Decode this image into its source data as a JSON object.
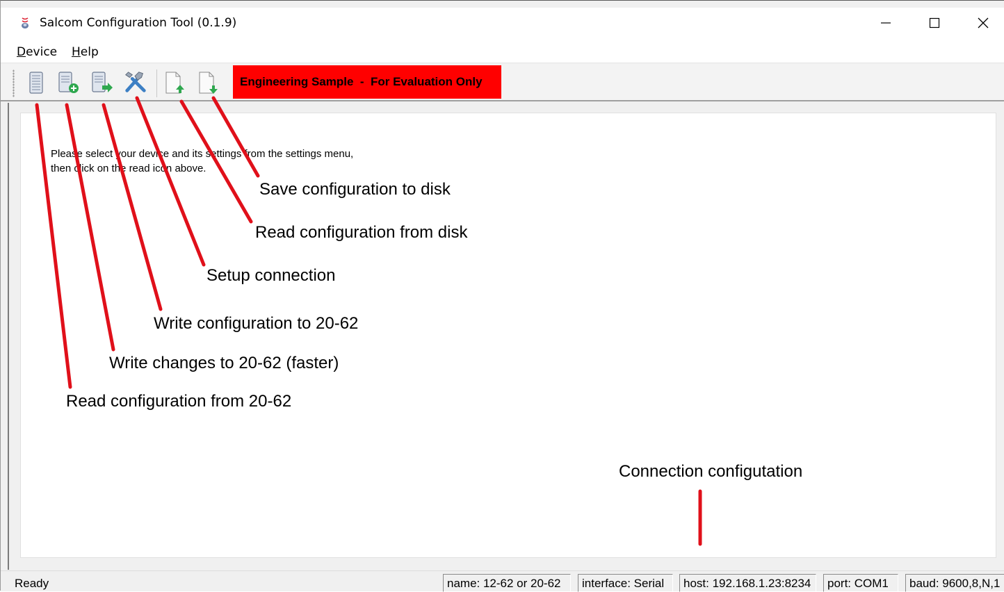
{
  "window": {
    "title": "Salcom Configuration Tool (0.1.9)",
    "controls": [
      "minimize",
      "maximize",
      "close"
    ]
  },
  "menu": {
    "items": [
      {
        "label_u": "D",
        "label_rest": "evice"
      },
      {
        "label_u": "H",
        "label_rest": "elp"
      }
    ]
  },
  "toolbar": {
    "buttons": [
      {
        "icon": "read-device-icon"
      },
      {
        "icon": "write-changes-icon"
      },
      {
        "icon": "write-config-icon"
      },
      {
        "icon": "setup-connection-icon"
      },
      {
        "icon": "read-from-disk-icon"
      },
      {
        "icon": "save-to-disk-icon"
      }
    ],
    "banner": "Engineering Sample  -  For Evaluation Only",
    "banner_color": "#ff0000"
  },
  "content": {
    "instruction_line1": "Please select your device and its settings from the settings menu,",
    "instruction_line2": "then click on the read icon above."
  },
  "annotations": {
    "save_disk": "Save configuration to disk",
    "read_disk": "Read configuration from disk",
    "setup_conn": "Setup connection",
    "write_config": "Write configuration to 20-62",
    "write_changes": "Write changes to 20-62 (faster)",
    "read_config": "Read configuration from 20-62",
    "conn_config": "Connection configutation",
    "arrow_color": "#e0101a"
  },
  "status": {
    "ready": "Ready",
    "name": "name: 12-62 or 20-62",
    "interface": "interface: Serial",
    "host": "host: 192.168.1.23:8234",
    "port": "port: COM1",
    "baud": "baud: 9600,8,N,1"
  }
}
